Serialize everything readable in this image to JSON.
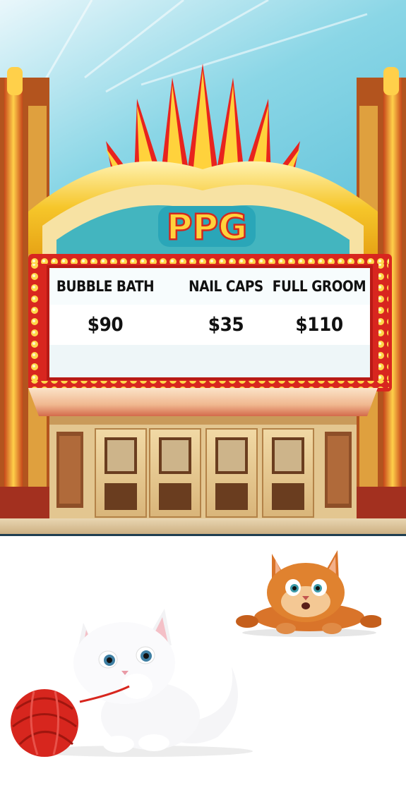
{
  "logo": {
    "text": "PPG"
  },
  "services": {
    "items": [
      {
        "name": "BUBBLE BATH",
        "price": "$90"
      },
      {
        "name": "NAIL CAPS",
        "price": "$35"
      },
      {
        "name": "FULL GROOM",
        "price": "$110"
      }
    ]
  },
  "colors": {
    "marquee_red": "#d8261f",
    "marquee_gold": "#f6c62a",
    "sky": "#5fc2da",
    "logo_teal": "#27b7c4"
  },
  "icons": [
    "theater-marquee-illustration",
    "orange-cat-illustration",
    "white-cat-illustration",
    "yarn-ball-icon"
  ]
}
